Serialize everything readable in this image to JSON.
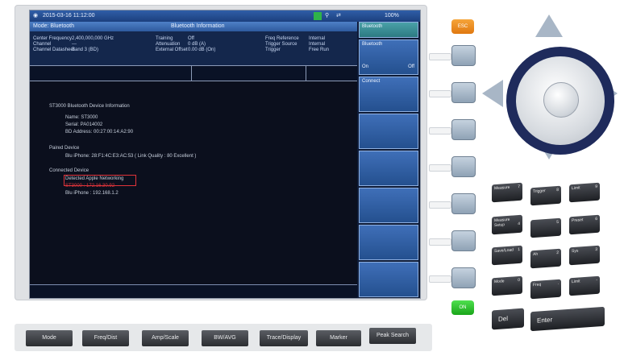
{
  "status_bar": {
    "datetime": "2015-03-16 11:12:00",
    "battery": "100%"
  },
  "mode_bar": {
    "mode": "Mode: Bluetooth",
    "screen_title": "Bluetooth Information"
  },
  "params": {
    "c1": {
      "l1": "Center Frequency",
      "v1": "2,400,000,000 GHz",
      "l2": "Channel",
      "v2": "---",
      "l3": "Channel Datasheet",
      "v3": "Band 3 (BD)"
    },
    "c2": {
      "l1": "Training",
      "v1": "Off",
      "l2": "Attenuation",
      "v2": "0 dB (A)",
      "l3": "External Offset",
      "v3": "0.00 dB (On)"
    },
    "c3": {
      "l1": "Freq Reference",
      "v1": "Internal",
      "l2": "Trigger Source",
      "v2": "Internal",
      "l3": "Trigger",
      "v3": "Free Run"
    }
  },
  "content": {
    "heading": "ST3000 Bluetooth Device Information",
    "name": "Name: ST3000",
    "serial": "Serial: PA014002",
    "address": "BD Address: 00:27:00:14:A2:90",
    "paired_heading": "Paired Device",
    "paired_item": "Blu iPhone: 28:F1:4C:E3:AC:53 ( Link Quality : 80 Excellent )",
    "connected_heading": "Connected Device",
    "connected_1": "Detected Apple Networking",
    "connected_2": "ST3000 : 172.16.30.92",
    "connected_3": "Blu iPhone : 192.168.1.2"
  },
  "softkeys": {
    "title": "Bluetooth",
    "bt_label": "Bluetooth",
    "bt_on": "On",
    "bt_off": "Off",
    "connect": "Connect"
  },
  "hard_keys": [
    "Mode",
    "Freq/Dist",
    "Amp/Scale",
    "BW/AVG",
    "Trace/Display",
    "Marker",
    "Peak Search"
  ],
  "right_keys": {
    "esc": "ESC",
    "on": "ON",
    "del": "Del",
    "enter": "Enter"
  },
  "numpad": [
    {
      "top": "Measure",
      "num": "7"
    },
    {
      "top": "Trigger",
      "num": "8"
    },
    {
      "top": "Limit",
      "num": "9"
    },
    {
      "top": "Measure Setup",
      "num": "4"
    },
    {
      "top": "",
      "num": "5"
    },
    {
      "top": "Preset",
      "num": "6"
    },
    {
      "top": "Save/Load",
      "num": "1"
    },
    {
      "top": "Ah",
      "num": "2"
    },
    {
      "top": "Sys",
      "num": "3"
    },
    {
      "top": "Mode",
      "num": "0"
    },
    {
      "top": "Freq",
      "num": "."
    },
    {
      "top": "Limit",
      "num": "-"
    }
  ],
  "colors": {
    "screen_bg": "#0b0f1d",
    "title_bar": "#2f5ea8",
    "softkey": "#3f6fb8",
    "highlight_box": "#e0343a",
    "esc_key": "#f6a53a",
    "on_key": "#1aa51a"
  }
}
